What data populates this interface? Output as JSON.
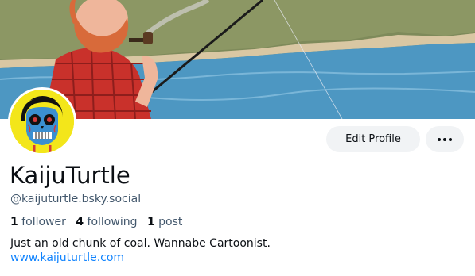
{
  "profile": {
    "display_name": "KaijuTurtle",
    "handle": "@kaijuturtle.bsky.social",
    "followers_count": "1",
    "followers_label": "follower",
    "following_count": "4",
    "following_label": "following",
    "posts_count": "1",
    "posts_label": "post",
    "bio": "Just an old chunk of coal. Wannabe Cartoonist.",
    "website": "www.kaijuturtle.com"
  },
  "actions": {
    "edit_label": "Edit Profile",
    "more_icon": "ellipsis-icon"
  },
  "colors": {
    "link": "#1083fe",
    "muted": "#42576c",
    "button_bg": "#f1f3f5",
    "avatar_bg": "#f3e61a"
  }
}
